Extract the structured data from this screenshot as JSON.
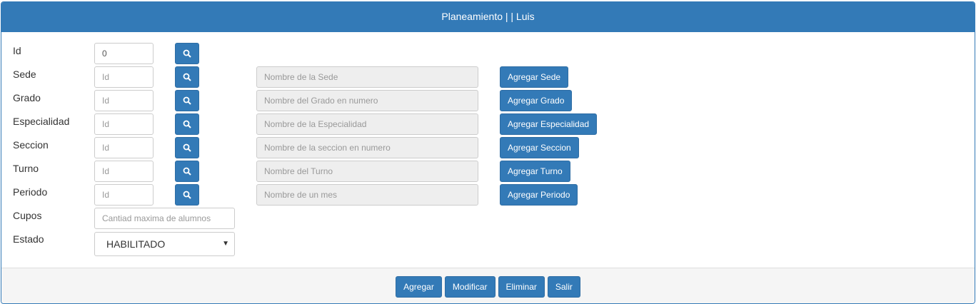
{
  "header": {
    "title": "Planeamiento | | Luis"
  },
  "colors": {
    "primary": "#337ab7",
    "readonly_bg": "#eeeeee",
    "footer_bg": "#f5f5f5"
  },
  "form": {
    "id": {
      "label": "Id",
      "value": "0",
      "search_icon": "search-icon"
    },
    "sede": {
      "label": "Sede",
      "id_placeholder": "Id",
      "name_placeholder": "Nombre de la Sede",
      "add_label": "Agregar Sede"
    },
    "grado": {
      "label": "Grado",
      "id_placeholder": "Id",
      "name_placeholder": "Nombre del Grado en numero",
      "add_label": "Agregar Grado"
    },
    "especialidad": {
      "label": "Especialidad",
      "id_placeholder": "Id",
      "name_placeholder": "Nombre de la Especialidad",
      "add_label": "Agregar Especialidad"
    },
    "seccion": {
      "label": "Seccion",
      "id_placeholder": "Id",
      "name_placeholder": "Nombre de la seccion en numero",
      "add_label": "Agregar Seccion"
    },
    "turno": {
      "label": "Turno",
      "id_placeholder": "Id",
      "name_placeholder": "Nombre del Turno",
      "add_label": "Agregar Turno"
    },
    "periodo": {
      "label": "Periodo",
      "id_placeholder": "Id",
      "name_placeholder": "Nombre de un mes",
      "add_label": "Agregar Periodo"
    },
    "cupos": {
      "label": "Cupos",
      "placeholder": "Cantiad maxima de alumnos"
    },
    "estado": {
      "label": "Estado",
      "selected": "HABILITADO"
    }
  },
  "footer": {
    "agregar": "Agregar",
    "modificar": "Modificar",
    "eliminar": "Eliminar",
    "salir": "Salir"
  }
}
